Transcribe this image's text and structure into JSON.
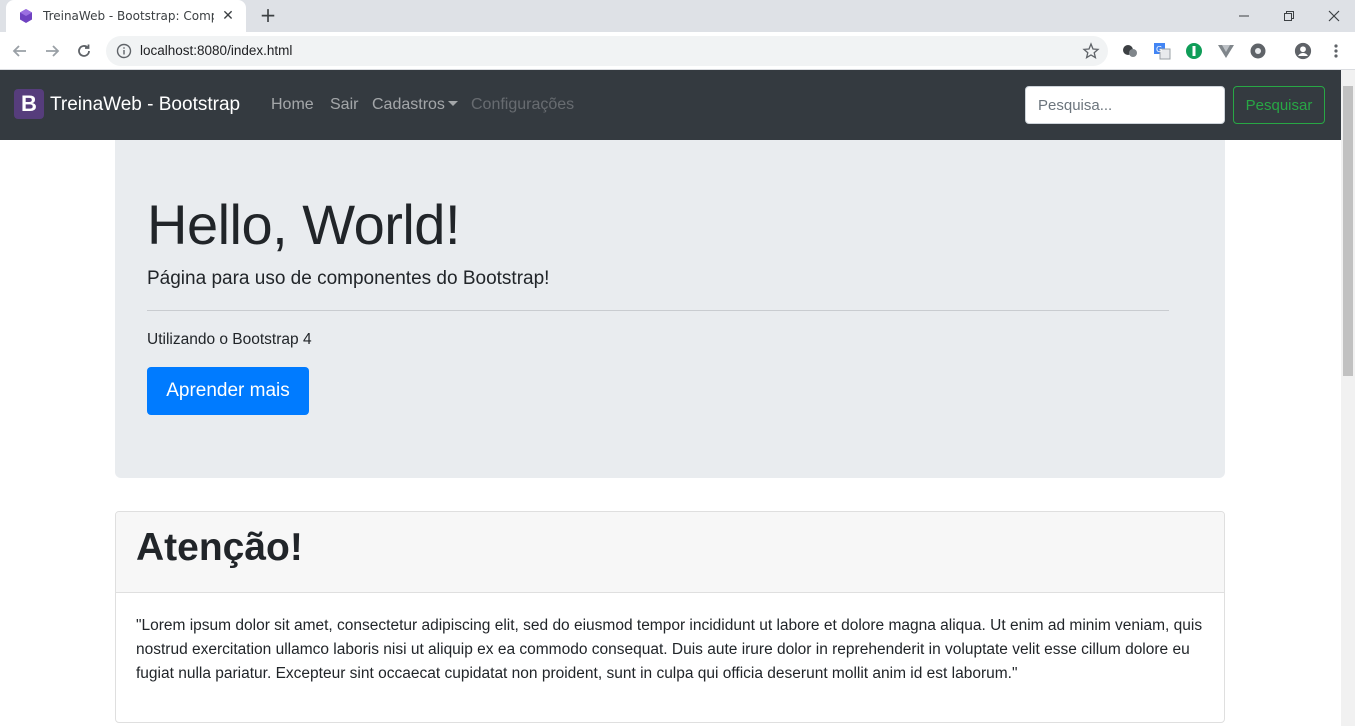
{
  "browser": {
    "tab_title": "TreinaWeb - Bootstrap: Componentes",
    "url": "localhost:8080/index.html",
    "accent": "#1a73e8"
  },
  "navbar": {
    "brand_logo": "B",
    "brand": "TreinaWeb - Bootstrap",
    "links": [
      {
        "label": "Home"
      },
      {
        "label": "Sair"
      },
      {
        "label": "Cadastros"
      },
      {
        "label": "Configurações"
      }
    ],
    "search_placeholder": "Pesquisa...",
    "search_button": "Pesquisar",
    "colors": {
      "background": "#343a40",
      "brand_logo": "#563d7c",
      "search_button": "#28a745"
    }
  },
  "jumbotron": {
    "title": "Hello, World!",
    "lead": "Página para uso de componentes do Bootstrap!",
    "text": "Utilizando o Bootstrap 4",
    "button": "Aprender mais",
    "colors": {
      "background": "#e9ecef",
      "button": "#007bff"
    }
  },
  "card": {
    "title": "Atenção!",
    "body": "\"Lorem ipsum dolor sit amet, consectetur adipiscing elit, sed do eiusmod tempor incididunt ut labore et dolore magna aliqua. Ut enim ad minim veniam, quis nostrud exercitation ullamco laboris nisi ut aliquip ex ea commodo consequat. Duis aute irure dolor in reprehenderit in voluptate velit esse cillum dolore eu fugiat nulla pariatur. Excepteur sint occaecat cupidatat non proident, sunt in culpa qui officia deserunt mollit anim id est laborum.\""
  },
  "icons": [
    "bootstrap-favicon-icon",
    "close-icon",
    "plus-icon",
    "minimize-icon",
    "restore-icon",
    "back-arrow-icon",
    "forward-arrow-icon",
    "reload-icon",
    "info-icon",
    "star-icon",
    "extension-icon",
    "translate-icon",
    "account-icon",
    "more-vert-icon"
  ]
}
